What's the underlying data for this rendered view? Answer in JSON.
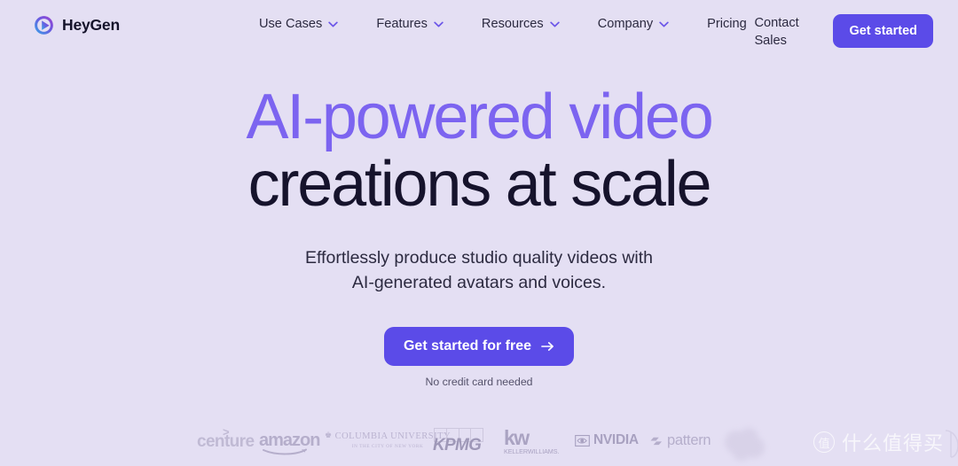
{
  "brand": {
    "name": "HeyGen",
    "logo_icon": "heygen-play-logo",
    "gradient_from": "#37a6e8",
    "gradient_to": "#8b3fd4"
  },
  "colors": {
    "background": "#e4dff3",
    "accent_purple": "#5b4be8",
    "headline_purple": "#7c64f0",
    "headline_dark": "#16132c",
    "body_text": "#2c2a40"
  },
  "nav": {
    "items": [
      {
        "label": "Use Cases",
        "has_chevron": true,
        "icon": "chevron-down-icon"
      },
      {
        "label": "Features",
        "has_chevron": true,
        "icon": "chevron-down-icon"
      },
      {
        "label": "Resources",
        "has_chevron": true,
        "icon": "chevron-down-icon"
      },
      {
        "label": "Company",
        "has_chevron": true,
        "icon": "chevron-down-icon"
      },
      {
        "label": "Pricing",
        "has_chevron": false,
        "icon": ""
      }
    ]
  },
  "header": {
    "contact_sales": "Contact Sales",
    "get_started": "Get started"
  },
  "hero": {
    "headline_line1": "AI-powered video",
    "headline_line2": "creations at scale",
    "subtitle": "Effortlessly produce studio quality videos with AI-generated avatars and voices.",
    "cta_label": "Get started for free",
    "cta_icon": "arrow-right-icon",
    "cta_note": "No credit card needed"
  },
  "logo_strip": {
    "logos": [
      {
        "name": "Accenture",
        "display": "centure",
        "note": "cropped at left edge"
      },
      {
        "name": "Amazon",
        "display": "amazon"
      },
      {
        "name": "Columbia University",
        "display": "COLUMBIA UNIVERSITY",
        "sub": "IN THE CITY OF NEW YORK"
      },
      {
        "name": "KPMG",
        "display": "KPMG"
      },
      {
        "name": "Keller Williams",
        "display": "kw",
        "sub": "KELLERWILLIAMS."
      },
      {
        "name": "NVIDIA",
        "display": "NVIDIA"
      },
      {
        "name": "Pattern",
        "display": "pattern"
      },
      {
        "name": "Blurred cloud logo",
        "display": ""
      }
    ]
  },
  "watermark": {
    "badge": "值",
    "text": "什么值得买"
  }
}
